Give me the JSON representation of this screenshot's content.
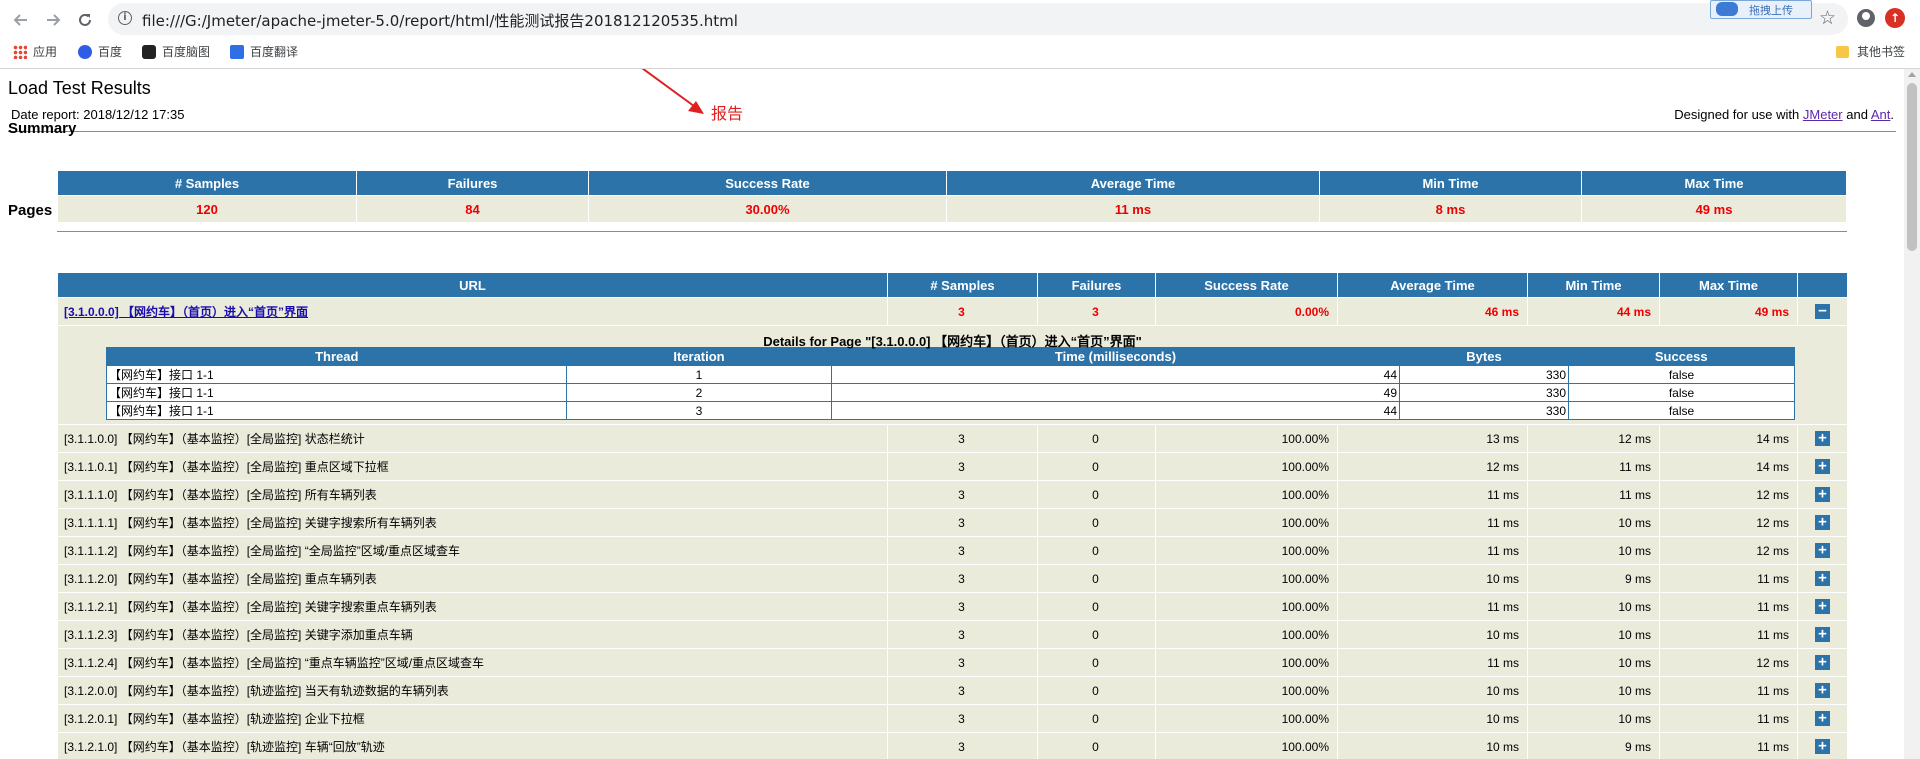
{
  "browser": {
    "url": "file:///G:/Jmeter/apache-jmeter-5.0/report/html/性能测试报告201812120535.html",
    "upload_label": "拖拽上传",
    "bookmarks": [
      "应用",
      "百度",
      "百度脑图",
      "百度翻译"
    ],
    "other_bookmarks": "其他书签"
  },
  "header": {
    "title": "Load Test Results",
    "date": "Date report: 2018/12/12 17:35",
    "designed_prefix": "Designed for use with",
    "jmeter_link": "JMeter",
    "and": "and",
    "ant_link": "Ant",
    "period": "."
  },
  "annotation": {
    "text": "报告",
    "color": "#e02020"
  },
  "summary": {
    "heading": "Summary",
    "columns": [
      "# Samples",
      "Failures",
      "Success Rate",
      "Average Time",
      "Min Time",
      "Max Time"
    ],
    "values": [
      "120",
      "84",
      "30.00%",
      "11 ms",
      "8 ms",
      "49 ms"
    ]
  },
  "pages": {
    "heading": "Pages",
    "columns": [
      "URL",
      "# Samples",
      "Failures",
      "Success Rate",
      "Average Time",
      "Min Time",
      "Max Time"
    ],
    "rows": [
      {
        "url": "[3.1.0.0.0] 【网约车】（首页）进入“首页”界面",
        "samples": "3",
        "failures": "3",
        "rate": "0.00%",
        "avg": "46 ms",
        "min": "44 ms",
        "max": "49 ms",
        "toggle": "−"
      },
      {
        "url": "[3.1.1.0.0] 【网约车】（基本监控）[全局监控] 状态栏统计",
        "samples": "3",
        "failures": "0",
        "rate": "100.00%",
        "avg": "13 ms",
        "min": "12 ms",
        "max": "14 ms",
        "toggle": "+"
      },
      {
        "url": "[3.1.1.0.1] 【网约车】（基本监控）[全局监控] 重点区域下拉框",
        "samples": "3",
        "failures": "0",
        "rate": "100.00%",
        "avg": "12 ms",
        "min": "11 ms",
        "max": "14 ms",
        "toggle": "+"
      },
      {
        "url": "[3.1.1.1.0] 【网约车】（基本监控）[全局监控] 所有车辆列表",
        "samples": "3",
        "failures": "0",
        "rate": "100.00%",
        "avg": "11 ms",
        "min": "11 ms",
        "max": "12 ms",
        "toggle": "+"
      },
      {
        "url": "[3.1.1.1.1] 【网约车】（基本监控）[全局监控] 关键字搜索所有车辆列表",
        "samples": "3",
        "failures": "0",
        "rate": "100.00%",
        "avg": "11 ms",
        "min": "10 ms",
        "max": "12 ms",
        "toggle": "+"
      },
      {
        "url": "[3.1.1.1.2] 【网约车】（基本监控）[全局监控] “全局监控”区域/重点区域查车",
        "samples": "3",
        "failures": "0",
        "rate": "100.00%",
        "avg": "11 ms",
        "min": "10 ms",
        "max": "12 ms",
        "toggle": "+"
      },
      {
        "url": "[3.1.1.2.0] 【网约车】（基本监控）[全局监控] 重点车辆列表",
        "samples": "3",
        "failures": "0",
        "rate": "100.00%",
        "avg": "10 ms",
        "min": "9 ms",
        "max": "11 ms",
        "toggle": "+"
      },
      {
        "url": "[3.1.1.2.1] 【网约车】（基本监控）[全局监控] 关键字搜索重点车辆列表",
        "samples": "3",
        "failures": "0",
        "rate": "100.00%",
        "avg": "11 ms",
        "min": "10 ms",
        "max": "11 ms",
        "toggle": "+"
      },
      {
        "url": "[3.1.1.2.3] 【网约车】（基本监控）[全局监控] 关键字添加重点车辆",
        "samples": "3",
        "failures": "0",
        "rate": "100.00%",
        "avg": "10 ms",
        "min": "10 ms",
        "max": "11 ms",
        "toggle": "+"
      },
      {
        "url": "[3.1.1.2.4] 【网约车】（基本监控）[全局监控] “重点车辆监控”区域/重点区域查车",
        "samples": "3",
        "failures": "0",
        "rate": "100.00%",
        "avg": "11 ms",
        "min": "10 ms",
        "max": "12 ms",
        "toggle": "+"
      },
      {
        "url": "[3.1.2.0.0] 【网约车】（基本监控）[轨迹监控] 当天有轨迹数据的车辆列表",
        "samples": "3",
        "failures": "0",
        "rate": "100.00%",
        "avg": "10 ms",
        "min": "10 ms",
        "max": "11 ms",
        "toggle": "+"
      },
      {
        "url": "[3.1.2.0.1] 【网约车】（基本监控）[轨迹监控] 企业下拉框",
        "samples": "3",
        "failures": "0",
        "rate": "100.00%",
        "avg": "10 ms",
        "min": "10 ms",
        "max": "11 ms",
        "toggle": "+"
      },
      {
        "url": "[3.1.2.1.0] 【网约车】（基本监控）[轨迹监控] 车辆“回放”轨迹",
        "samples": "3",
        "failures": "0",
        "rate": "100.00%",
        "avg": "10 ms",
        "min": "9 ms",
        "max": "11 ms",
        "toggle": "+"
      }
    ]
  },
  "details": {
    "title": "Details for Page \"[3.1.0.0.0] 【网约车】（首页）进入“首页”界面\"",
    "columns": [
      "Thread",
      "Iteration",
      "Time (milliseconds)",
      "Bytes",
      "Success"
    ],
    "rows": [
      {
        "thread": "【网约车】接口 1-1",
        "iteration": "1",
        "time": "44",
        "bytes": "330",
        "success": "false"
      },
      {
        "thread": "【网约车】接口 1-1",
        "iteration": "2",
        "time": "49",
        "bytes": "330",
        "success": "false"
      },
      {
        "thread": "【网约车】接口 1-1",
        "iteration": "3",
        "time": "44",
        "bytes": "330",
        "success": "false"
      }
    ]
  }
}
